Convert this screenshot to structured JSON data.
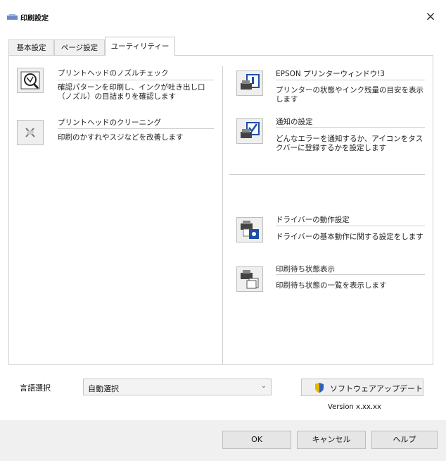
{
  "window": {
    "title": "印刷設定",
    "close_glyph": "×"
  },
  "tabs": [
    {
      "label": "基本設定",
      "active": false
    },
    {
      "label": "ページ設定",
      "active": false
    },
    {
      "label": "ユーティリティー",
      "active": true
    }
  ],
  "left_features": [
    {
      "icon": "nozzle-check-icon",
      "title": "プリントヘッドのノズルチェック",
      "description": "確認パターンを印刷し、インクが吐き出し口（ノズル）の目詰まりを確認します"
    },
    {
      "icon": "head-cleaning-icon",
      "title": "プリントヘッドのクリーニング",
      "description": "印刷のかすれやスジなどを改善します"
    }
  ],
  "right_features": [
    {
      "icon": "printer-window-icon",
      "title": "EPSON プリンターウィンドウ!3",
      "description": "プリンターの状態やインク残量の目安を表示します"
    },
    {
      "icon": "notification-icon",
      "title": "通知の設定",
      "description": "どんなエラーを通知するか、アイコンをタスクバーに登録するかを設定します"
    },
    {
      "icon": "driver-settings-icon",
      "title": "ドライバーの動作設定",
      "description": "ドライバーの基本動作に関する設定をします"
    },
    {
      "icon": "print-queue-icon",
      "title": "印刷待ち状態表示",
      "description": "印刷待ち状態の一覧を表示します"
    }
  ],
  "language": {
    "label": "言語選択",
    "value": "自動選択"
  },
  "update_button": {
    "label": "ソフトウェアアップデート",
    "icon": "shield-icon"
  },
  "version": "Version x.xx.xx",
  "dialog_buttons": {
    "ok": "OK",
    "cancel": "キャンセル",
    "help": "ヘルプ"
  }
}
